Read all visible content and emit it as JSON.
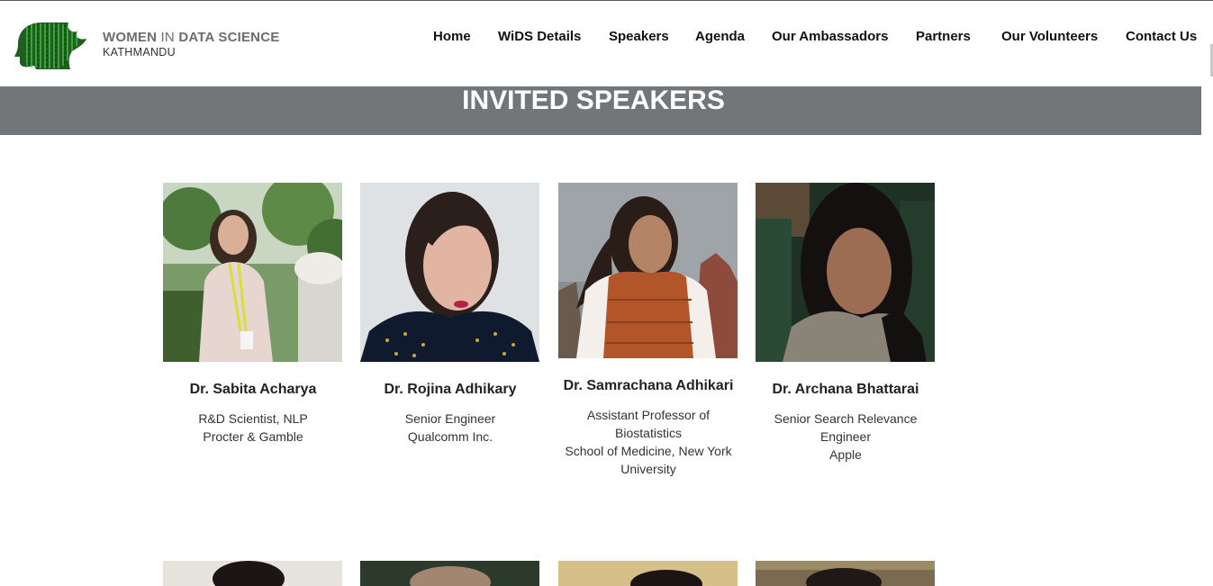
{
  "brand": {
    "title_bold_1": "WOMEN",
    "title_thin": "IN",
    "title_bold_2": "DATA SCIENCE",
    "subtitle": "KATHMANDU",
    "logo_icon": "woman-face-data-icon"
  },
  "nav": {
    "items": [
      {
        "label": "Home"
      },
      {
        "label": "WiDS Details"
      },
      {
        "label": "Speakers"
      },
      {
        "label": "Agenda"
      },
      {
        "label": "Our Ambassadors"
      },
      {
        "label": "Partners"
      },
      {
        "label": "Our Volunteers"
      },
      {
        "label": "Contact Us"
      }
    ]
  },
  "banner": {
    "title": "INVITED SPEAKERS"
  },
  "speakers": [
    {
      "name": "Dr. Sabita Acharya",
      "lines": [
        "R&D Scientist, NLP",
        "Procter & Gamble"
      ]
    },
    {
      "name": "Dr. Rojina Adhikary",
      "lines": [
        "Senior Engineer",
        "Qualcomm Inc."
      ]
    },
    {
      "name": "Dr. Samrachana Adhikari",
      "lines": [
        "Assistant Professor of",
        "Biostatistics",
        "School of Medicine, New York",
        "University"
      ]
    },
    {
      "name": "Dr. Archana Bhattarai",
      "lines": [
        "Senior Search Relevance",
        "Engineer",
        "Apple"
      ]
    }
  ],
  "colors": {
    "banner_bg": "#737679",
    "brand_gray": "#6d6d6d",
    "logo_green": "#2e8b2e"
  }
}
